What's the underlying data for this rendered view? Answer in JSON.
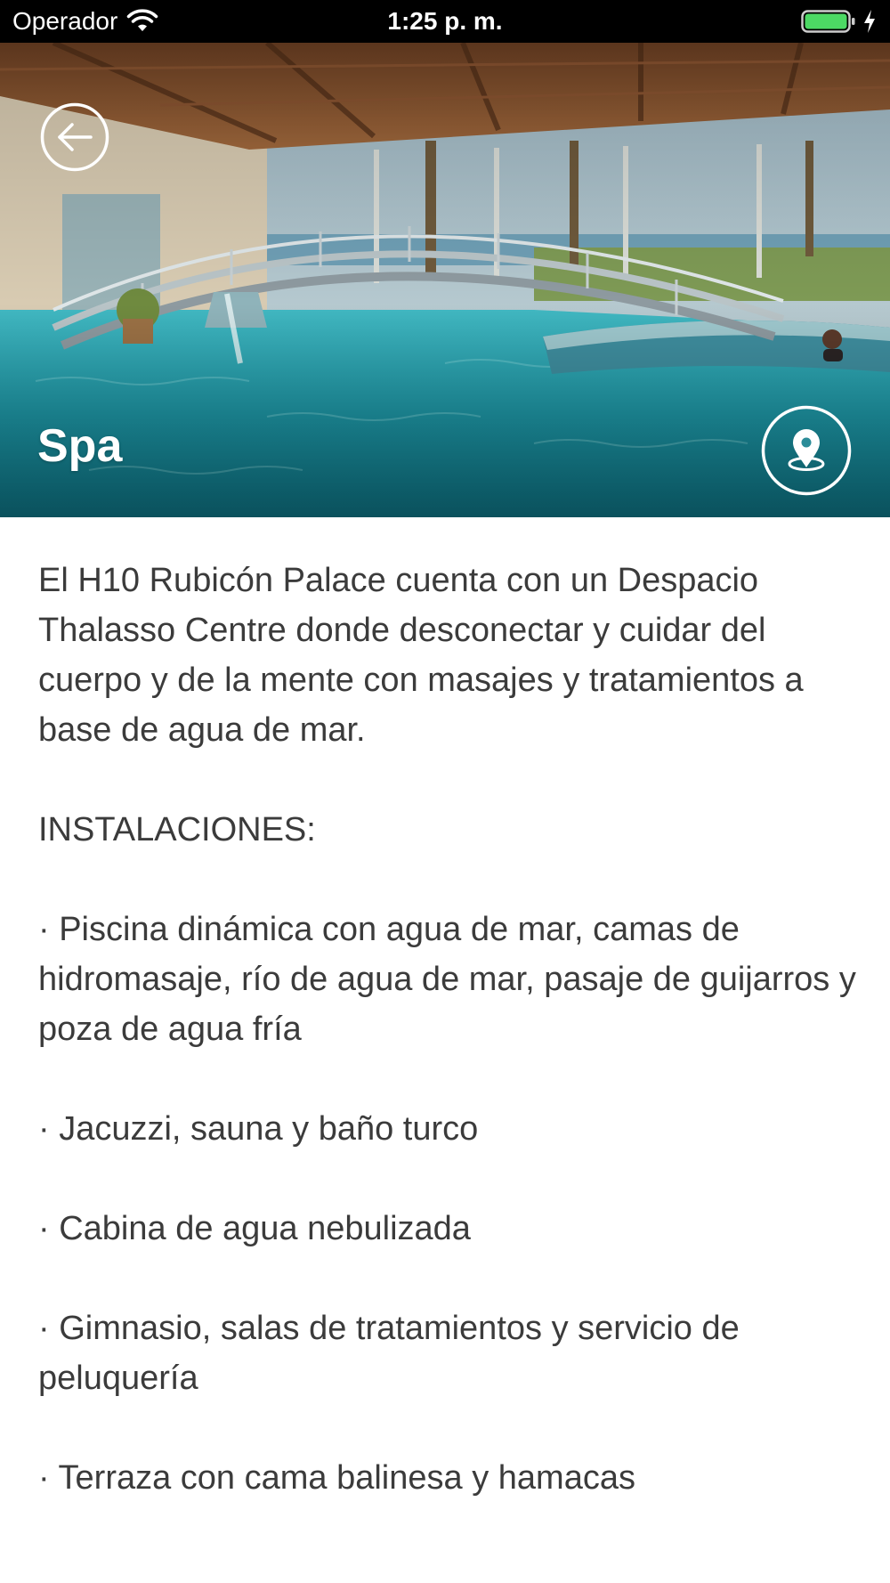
{
  "status_bar": {
    "carrier": "Operador",
    "time": "1:25 p. m.",
    "battery_level": 1.0,
    "icons": [
      "wifi-icon",
      "battery-icon",
      "charging-icon"
    ]
  },
  "hero": {
    "title": "Spa",
    "icons": [
      "back-arrow-icon",
      "map-pin-icon"
    ]
  },
  "content": {
    "intro": "El H10 Rubicón Palace cuenta con un Despacio Thalasso Centre donde desconectar y cuidar del cuerpo y de la mente con masajes y tratamientos a base de agua de mar.",
    "section_heading": "INSTALACIONES:",
    "items": [
      "· Piscina dinámica con agua de mar, camas de hidromasaje, río de agua de mar, pasaje de guijarros y poza de agua fría",
      "· Jacuzzi, sauna y baño turco",
      "· Cabina de agua nebulizada",
      "· Gimnasio, salas de tratamientos y servicio de peluquería",
      "· Terraza con cama balinesa y hamacas"
    ]
  },
  "colors": {
    "status_bar_bg": "#000000",
    "battery_green": "#4cd964",
    "body_text": "#3b3b3b",
    "pool_water": "#1fa3b3"
  }
}
